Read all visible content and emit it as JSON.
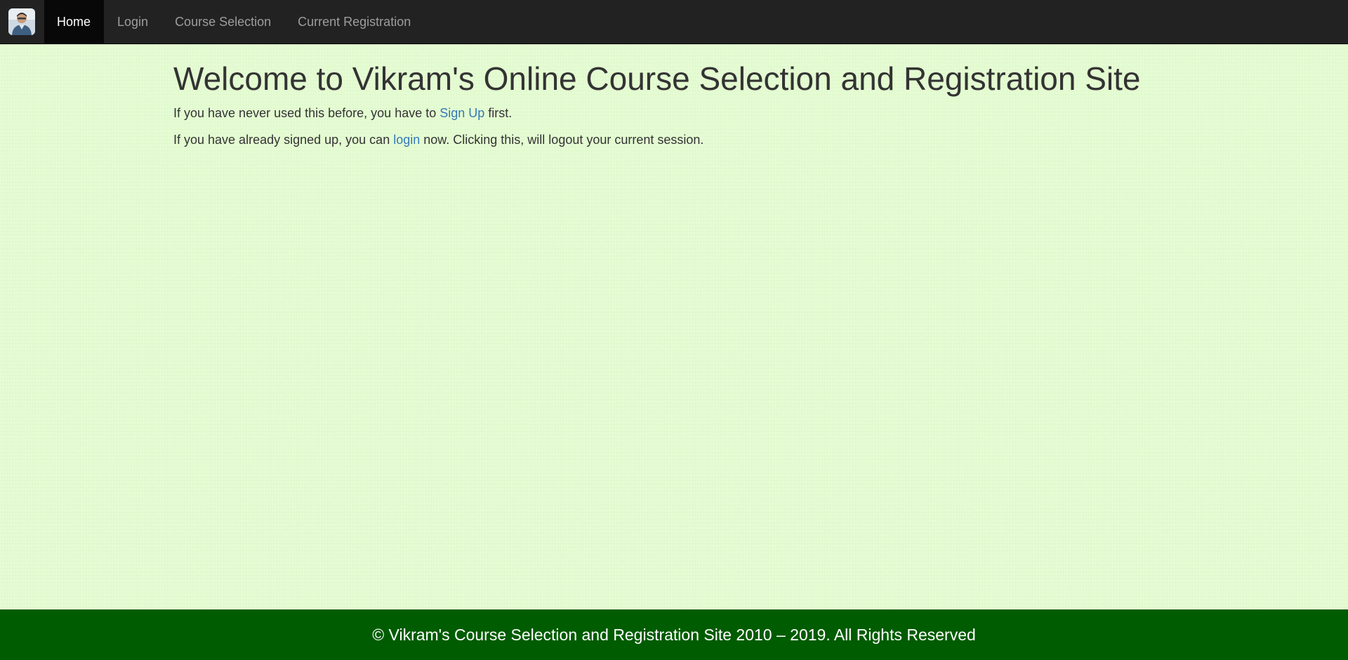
{
  "navbar": {
    "brand_icon": "user-avatar-icon",
    "items": [
      {
        "label": "Home",
        "active": true
      },
      {
        "label": "Login",
        "active": false
      },
      {
        "label": "Course Selection",
        "active": false
      },
      {
        "label": "Current Registration",
        "active": false
      }
    ]
  },
  "main": {
    "title": "Welcome to Vikram's Online Course Selection and Registration Site",
    "line1": {
      "before": "If you have never used this before, you have to ",
      "link": "Sign Up",
      "after": " first."
    },
    "line2": {
      "before": "If you have already signed up, you can ",
      "link": "login",
      "after": " now. Clicking this, will logout your current session."
    }
  },
  "footer": {
    "text": "© Vikram's Course Selection and Registration Site 2010 – 2019. All Rights Reserved"
  },
  "colors": {
    "navbar_bg": "#222222",
    "page_bg": "#e3fbd0",
    "link": "#337ab7",
    "footer_bg": "#005c00"
  }
}
